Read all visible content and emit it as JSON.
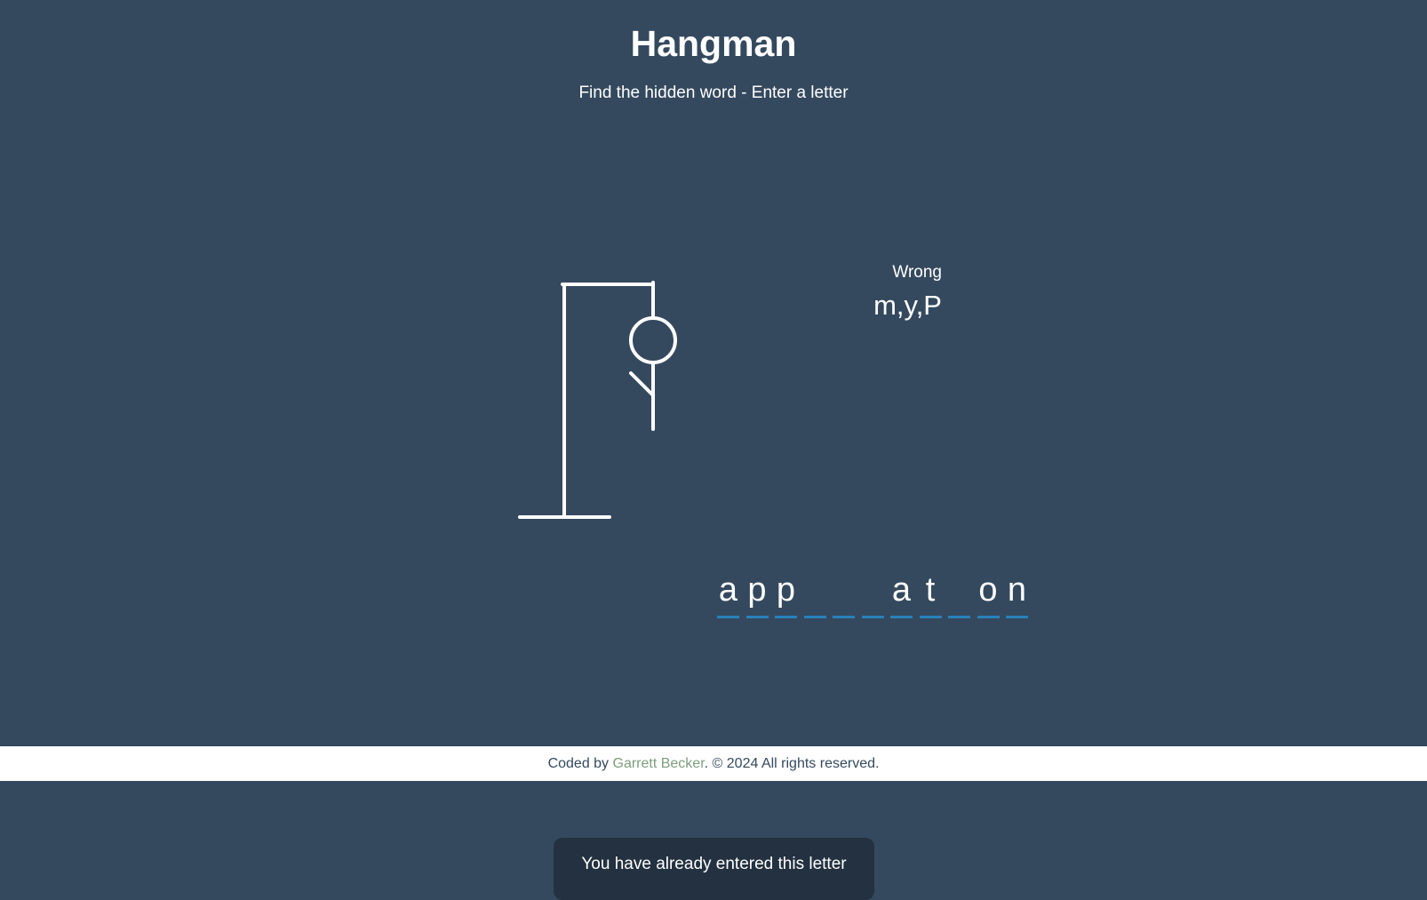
{
  "header": {
    "title": "Hangman",
    "subtitle": "Find the hidden word - Enter a letter"
  },
  "wrong": {
    "label": "Wrong",
    "letters": "m,y,P"
  },
  "word": {
    "letters": [
      "a",
      "p",
      "p",
      "",
      "",
      "",
      "a",
      "t",
      "",
      "o",
      "n"
    ]
  },
  "hangman": {
    "parts_shown": [
      "head",
      "body",
      "left-arm"
    ],
    "wrong_count": 3
  },
  "footer": {
    "prefix": "Coded by ",
    "author": "Garrett Becker",
    "suffix": ". © 2024 All rights reserved."
  },
  "notification": {
    "message": "You have already entered this letter"
  },
  "colors": {
    "background": "#34495e",
    "accent": "#2980b9",
    "link": "#7d9e7d",
    "notification_bg": "#233140"
  }
}
